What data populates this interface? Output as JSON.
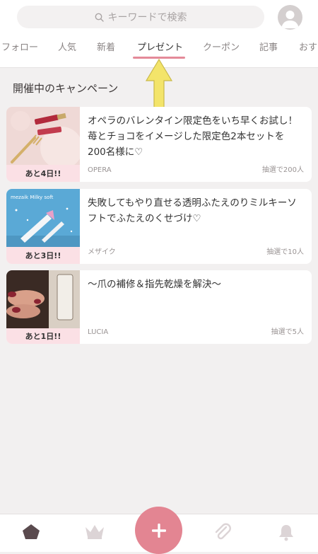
{
  "search": {
    "placeholder": "キーワードで検索"
  },
  "tabs": [
    {
      "label": "フォロー"
    },
    {
      "label": "人気"
    },
    {
      "label": "新着"
    },
    {
      "label": "プレゼント",
      "active": true
    },
    {
      "label": "クーポン"
    },
    {
      "label": "記事"
    },
    {
      "label": "おすす"
    }
  ],
  "section": {
    "title": "開催中のキャンペーン"
  },
  "campaigns": [
    {
      "title": "オペラのバレンタイン限定色をいち早くお試し！苺とチョコをイメージした限定色2本セットを200名様に♡",
      "brand": "OPERA",
      "winners": "抽選で200人",
      "days_left": "あと4日!!"
    },
    {
      "title": "失敗してもやり直せる透明ふたえのりミルキーソフトでふたえのくせづけ♡",
      "brand": "メザイク",
      "winners": "抽選で10人",
      "days_left": "あと3日!!",
      "image_text": "mezaik  Milky soft"
    },
    {
      "title": "〜爪の補修＆指先乾燥を解決〜",
      "brand": "LUCIA",
      "winners": "抽選で5人",
      "days_left": "あと1日!!"
    }
  ],
  "colors": {
    "accent": "#e38592",
    "tab_underline": "#e48a99",
    "badge_bg": "#fbe0e5",
    "arrow": "#f3e46a"
  },
  "nav": {
    "icons": [
      "home-icon",
      "crown-icon",
      "add-icon",
      "clip-icon",
      "bell-icon"
    ]
  }
}
